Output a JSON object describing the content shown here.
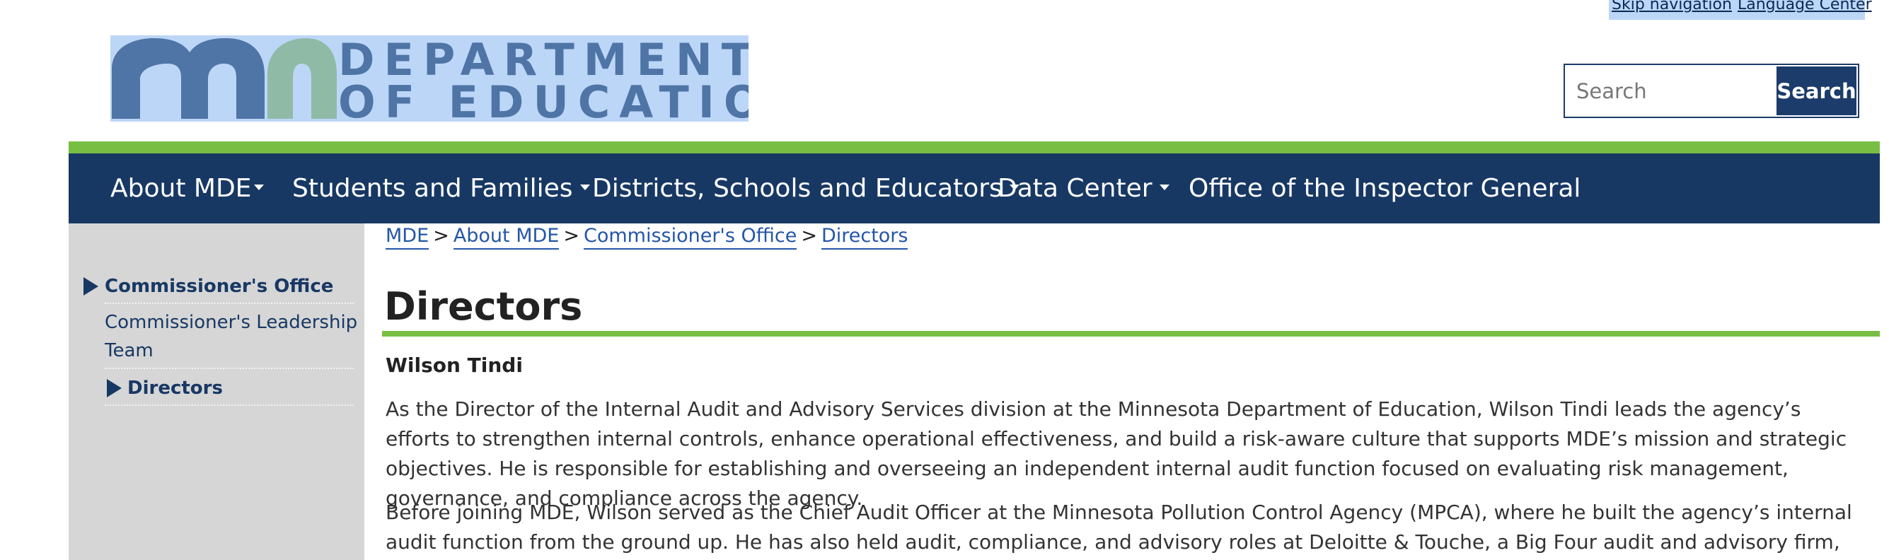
{
  "utility": {
    "skip": "Skip navigation",
    "language": "Language Center"
  },
  "logo": {
    "line1": "DEPARTMENT",
    "line2": "OF EDUCATION",
    "colors": {
      "blue": "#4f74a6",
      "green": "#8fbba6",
      "background": "#bcd6f7"
    }
  },
  "search": {
    "placeholder": "Search",
    "button": "Search"
  },
  "nav": {
    "items": [
      {
        "label": "About MDE"
      },
      {
        "label": "Students and Families"
      },
      {
        "label": "Districts, Schools and Educators"
      },
      {
        "label": "Data Center"
      },
      {
        "label": "Office of the Inspector General"
      }
    ]
  },
  "sidebar": {
    "heading": "Commissioner's Office",
    "item1": "Commissioner's Leadership Team",
    "item1_line1": "Commissioner's Leadership",
    "item1_line2": "Team",
    "item2": "Directors"
  },
  "breadcrumb": {
    "items": [
      "MDE",
      "About MDE",
      "Commissioner's Office",
      "Directors"
    ],
    "separator": ">"
  },
  "page": {
    "title": "Directors",
    "person": "Wilson Tindi",
    "paragraph1": "As the Director of the Internal Audit and Advisory Services division at the Minnesota Department of Education, Wilson Tindi leads the agency’s efforts to strengthen internal controls, enhance operational effectiveness, and build a risk-aware culture that supports MDE’s mission and strategic objectives. He is responsible for establishing and overseeing an independent internal audit function focused on evaluating risk management, governance, and compliance across the agency.",
    "paragraph2": "Before joining MDE, Wilson served as the Chief Audit Officer at the Minnesota Pollution Control Agency (MPCA), where he built the agency’s internal audit function from the ground up. He has also held audit, compliance, and advisory roles at Deloitte & Touche, a Big Four audit and advisory firm, as well as in the private sector at UnitedHealth"
  },
  "colors": {
    "navy": "#183864",
    "green": "#78be43",
    "link": "#2456a8",
    "sidebar": "#d6d6d6"
  }
}
